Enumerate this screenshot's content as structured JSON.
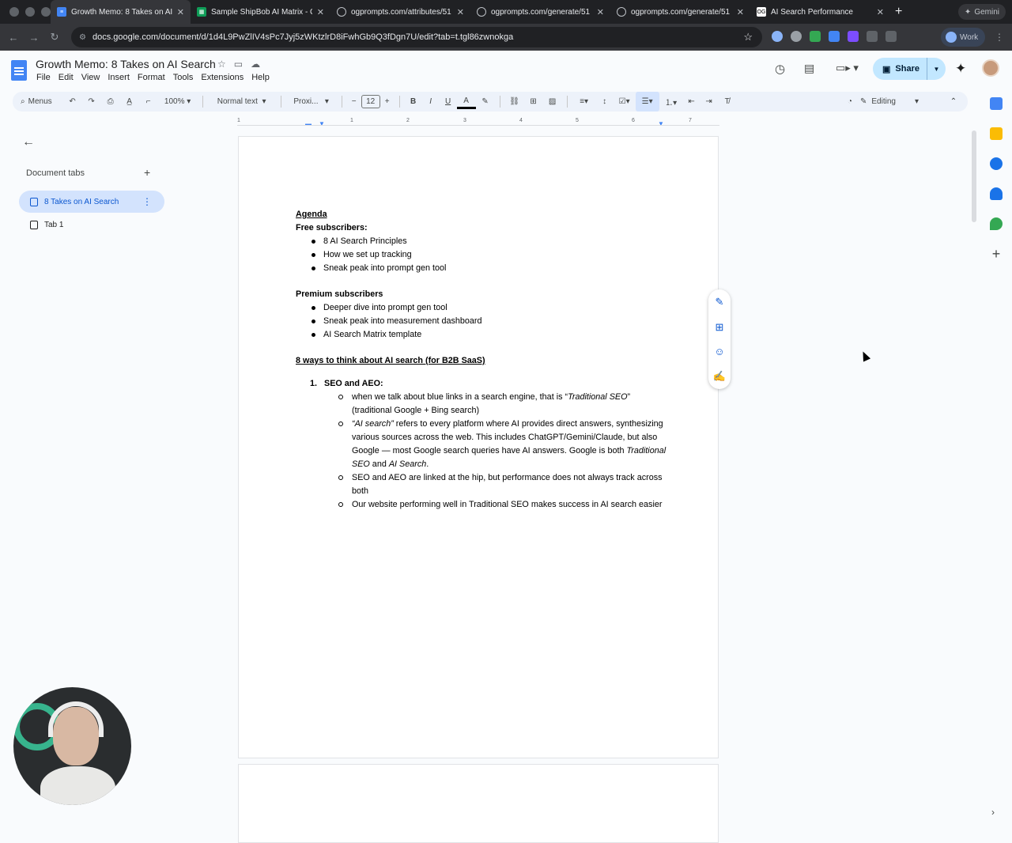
{
  "browser": {
    "tabs": [
      {
        "title": "Growth Memo: 8 Takes on AI",
        "icon": "docs-icon",
        "color": "#4285f4",
        "active": true
      },
      {
        "title": "Sample ShipBob AI Matrix - G",
        "icon": "sheets-icon",
        "color": "#0f9d58",
        "active": false
      },
      {
        "title": "ogprompts.com/attributes/51",
        "icon": "globe-icon",
        "color": "#5f6368",
        "active": false
      },
      {
        "title": "ogprompts.com/generate/51",
        "icon": "globe-icon",
        "color": "#5f6368",
        "active": false
      },
      {
        "title": "ogprompts.com/generate/51",
        "icon": "globe-icon",
        "color": "#5f6368",
        "active": false
      },
      {
        "title": "AI Search Performance",
        "icon": "og-icon",
        "color": "#ffffff",
        "active": false
      }
    ],
    "gemini_label": "Gemini",
    "url": "docs.google.com/document/d/1d4L9PwZlIV4sPc7Jyj5zWKtzlrD8iFwhGb9Q3fDgn7U/edit?tab=t.tgl86zwnokga",
    "profile_label": "Work"
  },
  "doc": {
    "title": "Growth Memo: 8 Takes on AI Search",
    "menu": [
      "File",
      "Edit",
      "View",
      "Insert",
      "Format",
      "Tools",
      "Extensions",
      "Help"
    ],
    "share_label": "Share"
  },
  "toolbar": {
    "search_label": "Menus",
    "zoom": "100%",
    "style": "Normal text",
    "font": "Proxi...",
    "font_size": "12",
    "mode": "Editing"
  },
  "ruler_ticks": [
    "1",
    "1",
    "2",
    "3",
    "4",
    "5",
    "6",
    "7"
  ],
  "sidebar": {
    "heading": "Document tabs",
    "tabs": [
      {
        "label": "8 Takes on AI Search",
        "selected": true
      },
      {
        "label": "Tab 1",
        "selected": false
      }
    ]
  },
  "content": {
    "agenda": "Agenda",
    "free_heading": "Free subscribers:",
    "free_items": [
      "8 AI Search Principles",
      "How we set up tracking",
      "Sneak peak into prompt gen tool"
    ],
    "premium_heading": "Premium subscribers",
    "premium_items": [
      "Deeper dive into prompt gen tool",
      "Sneak peak into measurement dashboard",
      "AI Search Matrix template"
    ],
    "ways_heading": "8 ways to think about AI search (for B2B SaaS)",
    "point1": {
      "number": "1.",
      "title": "SEO and AEO:",
      "b1_pre": "when we talk about blue links in a search engine, that is “",
      "b1_em": "Traditional SEO",
      "b1_post": "” (traditional Google + Bing search)",
      "b2_em": "“AI search”",
      "b2_post": " refers to every platform where AI provides direct answers, synthesizing various sources across the web. This includes ChatGPT/Gemini/Claude, but also Google — most Google search queries have AI answers. Google is both ",
      "b2_em2": "Traditional SEO",
      "b2_and": " and ",
      "b2_em3": "AI Search",
      "b2_end": ".",
      "b3": "SEO and AEO are linked at the hip, but performance does not always track across both",
      "b4": "Our website performing well in Traditional SEO makes success in AI search easier"
    }
  },
  "colors": {
    "accent": "#0b57d0",
    "share_bg": "#c2e7ff",
    "tab_selected": "#d3e3fd"
  }
}
